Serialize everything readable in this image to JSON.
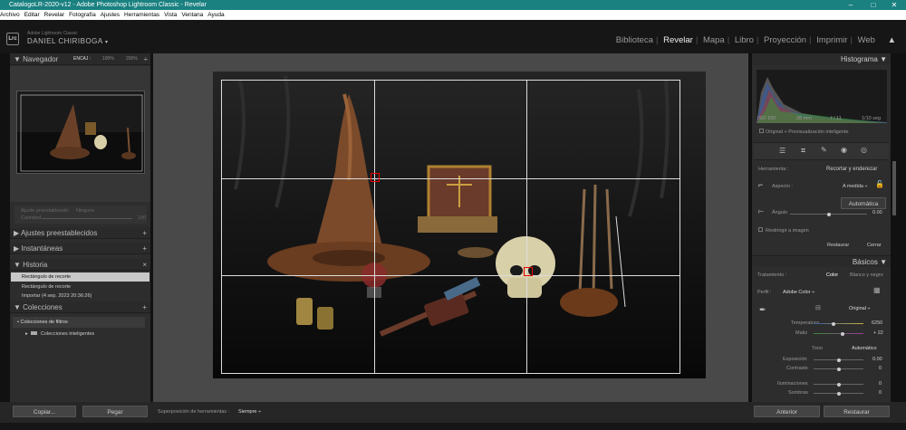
{
  "window": {
    "title": "CatalogoLR-2020-v12 - Adobe Photoshop Lightroom Classic - Revelar",
    "controls": [
      "–",
      "□",
      "✕"
    ]
  },
  "menu": [
    "Archivo",
    "Editar",
    "Revelar",
    "Fotografía",
    "Ajustes",
    "Herramientas",
    "Vista",
    "Ventana",
    "Ayuda"
  ],
  "identity": {
    "logo": "Lrc",
    "product": "Adobe Lightroom Classic",
    "user": "DANIEL CHIRIBOGA"
  },
  "modules": [
    "Biblioteca",
    "Revelar",
    "Mapa",
    "Libro",
    "Proyección",
    "Imprimir",
    "Web"
  ],
  "active_module": "Revelar",
  "left": {
    "navigator": {
      "label": "Navegador",
      "zoom": [
        "ENCAJ :",
        "100%",
        "200%"
      ]
    },
    "preset_amount": {
      "label": "Ajuste preestablecido",
      "value": "Ninguno",
      "amount_label": "Cantidad",
      "amount_value": "100"
    },
    "presets_label": "Ajustes preestablecidos",
    "snapshots_label": "Instantáneas",
    "history": {
      "label": "Historia",
      "close": "×",
      "items": [
        "Rectángulo de recorte",
        "Rectángulo de recorte",
        "Importar (4 sep. 2023 20:36:26)"
      ]
    },
    "collections": {
      "label": "Colecciones",
      "items": [
        "Colecciones de filtros",
        "Colecciones inteligentes"
      ]
    },
    "copy_button": "Copiar...",
    "paste_button": "Pegar"
  },
  "toolbar": {
    "overlay_label": "Superposición de herramientas :",
    "overlay_value": "Siempre"
  },
  "right": {
    "histogram": {
      "label": "Histograma",
      "info": [
        "ISO 100",
        "28 mm",
        "f / 11",
        "1/10 seg"
      ],
      "status": "Original + Previsualización inteligente"
    },
    "crop": {
      "tool_label": "Herramienta :",
      "tool_name": "Recortar y enderezar",
      "aspect_label": "Aspecto :",
      "aspect_value": "A medida ÷",
      "auto_button": "Automática",
      "angle_label": "Ángulo",
      "angle_value": "0.00",
      "constrain_label": "Restringir a imagen",
      "reset_button": "Restaurar",
      "close_button": "Cerrar"
    },
    "basic": {
      "label": "Básicos",
      "treatment_label": "Tratamiento :",
      "treatment_color": "Color",
      "treatment_bw": "Blanco y negro",
      "profile_label": "Perfil :",
      "profile_value": "Adobe Color ÷",
      "wb_value": "Original ÷",
      "temp_label": "Temperatura",
      "temp_value": "6250",
      "tint_label": "Matiz",
      "tint_value": "+ 22",
      "tone_label": "Tono",
      "tone_auto": "Automático",
      "exposure_label": "Exposición",
      "exposure_value": "0.00",
      "contrast_label": "Contraste",
      "contrast_value": "0",
      "highlights_label": "Iluminaciones",
      "highlights_value": "0",
      "shadows_label": "Sombras",
      "shadows_value": "0"
    },
    "prev_button": "Anterior",
    "reset_button": "Restaurar"
  }
}
